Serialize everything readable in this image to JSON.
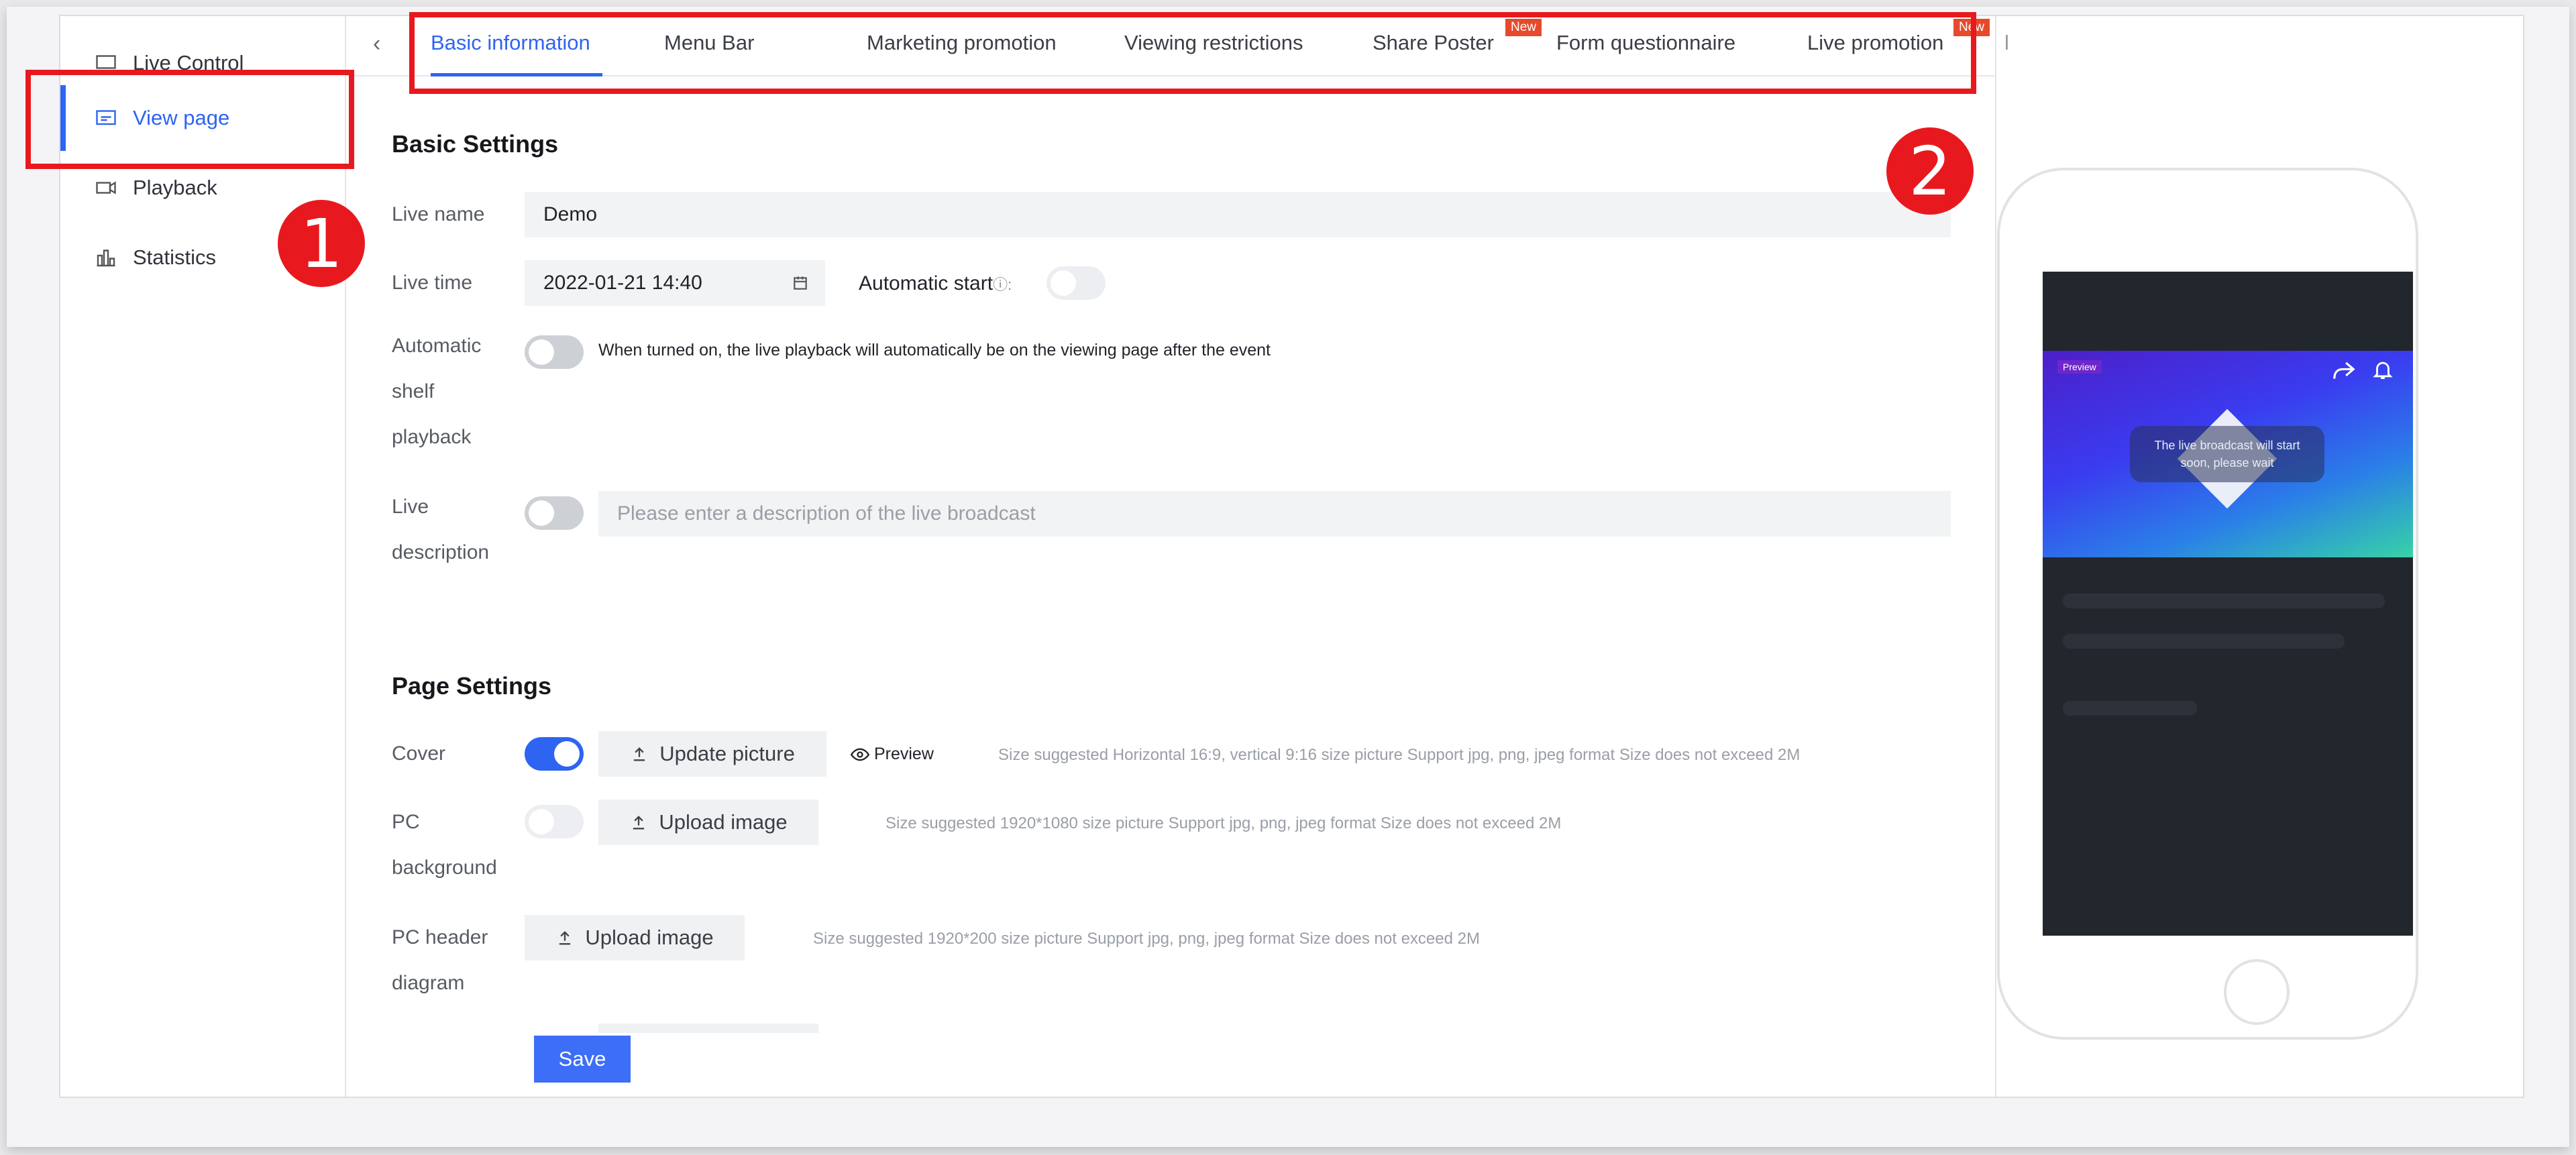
{
  "sidebar": {
    "items": [
      {
        "label": "Live Control",
        "icon": "monitor-icon"
      },
      {
        "label": "View page",
        "icon": "layout-icon"
      },
      {
        "label": "Playback",
        "icon": "video-icon"
      },
      {
        "label": "Statistics",
        "icon": "bar-chart-icon"
      }
    ],
    "active_index": 1
  },
  "tabs": [
    {
      "label": "Basic information",
      "active": true
    },
    {
      "label": "Menu Bar"
    },
    {
      "label": "Marketing promotion"
    },
    {
      "label": "Viewing restrictions"
    },
    {
      "label": "Share Poster",
      "badge": "New"
    },
    {
      "label": "Form questionnaire"
    },
    {
      "label": "Live promotion",
      "badge": "New"
    },
    {
      "label": "l"
    }
  ],
  "annotations": {
    "one": "1",
    "two": "2"
  },
  "basic": {
    "title": "Basic Settings",
    "live_name_label": "Live name",
    "live_name_value": "Demo",
    "live_time_label": "Live time",
    "live_time_value": "2022-01-21 14:40",
    "auto_start_label": "Automatic start",
    "auto_start_suffix": "ⓘ:",
    "auto_shelf_label": [
      "Automatic",
      "shelf",
      "playback"
    ],
    "auto_shelf_note": "When turned on, the live playback will automatically be on the viewing page after the event",
    "live_desc_label": [
      "Live",
      "description"
    ],
    "live_desc_placeholder": "Please enter a description of the live broadcast"
  },
  "page_settings": {
    "title": "Page Settings",
    "cover_label": "Cover",
    "cover_button": "Update picture",
    "preview_label": "Preview",
    "cover_hint": "Size suggested Horizontal 16:9, vertical 9:16 size picture  Support jpg, png, jpeg format  Size does not exceed 2M",
    "pc_bg_label": [
      "PC",
      "background"
    ],
    "pc_bg_button": "Upload image",
    "pc_bg_hint": "Size suggested 1920*1080 size picture  Support jpg, png, jpeg format  Size does not exceed 2M",
    "pc_header_label": [
      "PC header",
      "diagram"
    ],
    "pc_header_button": "Upload image",
    "pc_header_hint": "Size suggested 1920*200 size picture  Support jpg, png, jpeg format  Size does not exceed 2M"
  },
  "save_label": "Save",
  "phone": {
    "preview_tag": "Preview",
    "message": "The live broadcast will start soon, please wait"
  },
  "colors": {
    "accent": "#2e64f2",
    "highlight": "#e8191e",
    "badge": "#e64a2c"
  }
}
